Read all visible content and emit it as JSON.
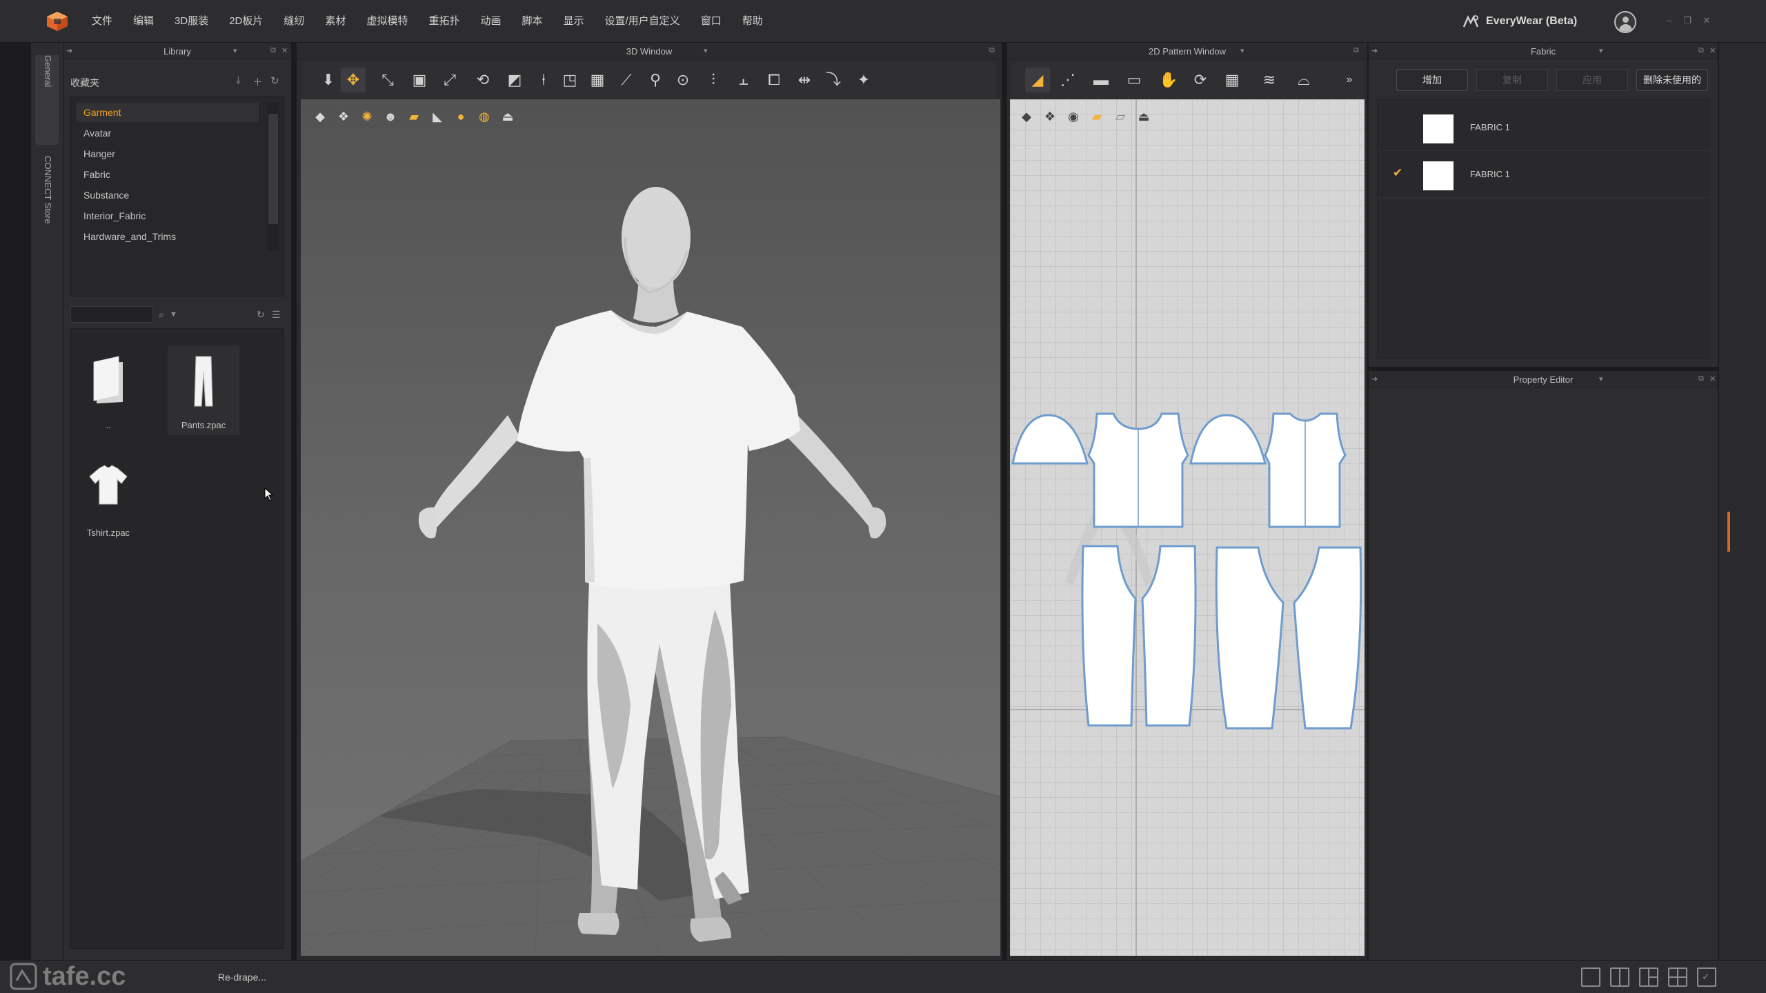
{
  "menubar": {
    "items": [
      "文件",
      "编辑",
      "3D服装",
      "2D板片",
      "缝纫",
      "素材",
      "虚拟模特",
      "重拓扑",
      "动画",
      "脚本",
      "显示",
      "设置/用户自定义",
      "窗口",
      "帮助"
    ],
    "brand": "EveryWear (Beta)"
  },
  "side_tabs": {
    "general": "General",
    "connect": "CONNECT Store"
  },
  "library": {
    "title": "Library",
    "favorites_title": "收藏夹",
    "categories": [
      "Garment",
      "Avatar",
      "Hanger",
      "Fabric",
      "Substance",
      "Interior_Fabric",
      "Hardware_and_Trims"
    ],
    "selected_category": "Garment",
    "search_placeholder": "",
    "files": [
      {
        "label": "..",
        "icon": "folder-up-icon"
      },
      {
        "label": "Pants.zpac",
        "icon": "pants-thumbnail"
      },
      {
        "label": "Tshirt.zpac",
        "icon": "tshirt-thumbnail"
      }
    ]
  },
  "window_3d": {
    "title": "3D Window"
  },
  "window_2d": {
    "title": "2D Pattern Window"
  },
  "fabric": {
    "title": "Fabric",
    "buttons": [
      "增加",
      "复制",
      "应用",
      "删除未使用的"
    ],
    "disabled_buttons": [
      "复制",
      "应用"
    ],
    "items": [
      {
        "name": "FABRIC 1",
        "checked": false
      },
      {
        "name": "FABRIC 1",
        "checked": true
      }
    ]
  },
  "property_editor": {
    "title": "Property Editor"
  },
  "statusbar": {
    "status": "Re-drape...",
    "watermark": "tafe.cc"
  },
  "colors": {
    "accent": "#f2b33a",
    "panel": "#2d2d30",
    "background": "#1b1b1d",
    "pattern_outline": "#6e9ccf"
  }
}
